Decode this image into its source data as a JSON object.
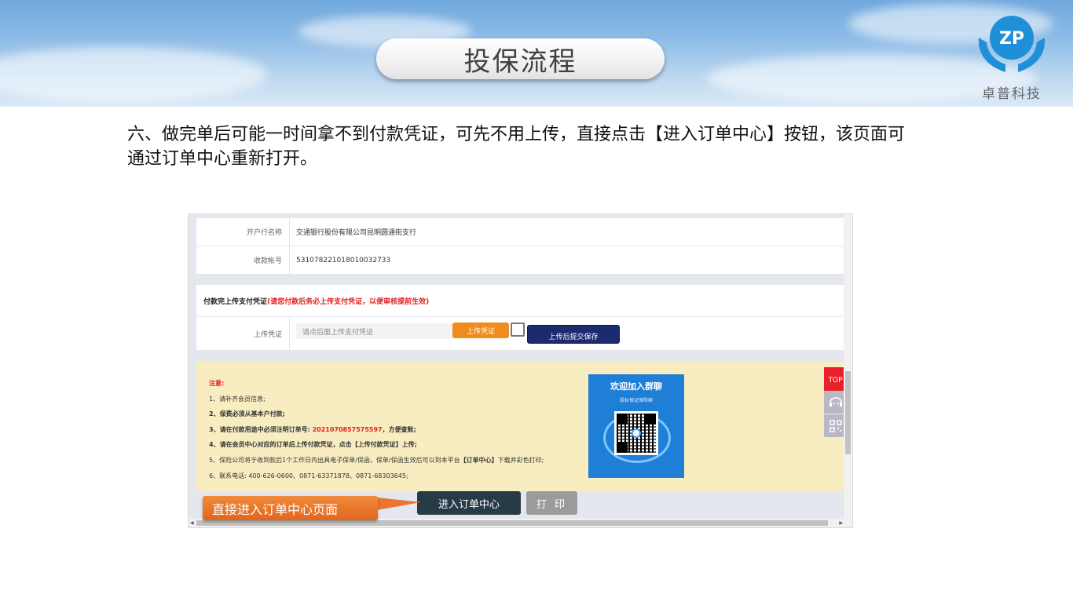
{
  "slide": {
    "title": "投保流程",
    "logo_text": "卓普科技",
    "instruction": "六、做完单后可能一时间拿不到付款凭证，可先不用上传，直接点击【进入订单中心】按钮，该页面可通过订单中心重新打开。"
  },
  "account": {
    "bank_label": "开户行名称",
    "bank_value": "交通银行股份有限公司昆明圆通街支行",
    "acct_label": "收款帐号",
    "acct_value": "531078221018010032733"
  },
  "upload": {
    "section_title": "付款完上传支付凭证",
    "section_warning": "(请您付款后务必上传支付凭证，以便审核提前生效)",
    "label": "上传凭证",
    "placeholder": "请点后面上传支付凭证",
    "upload_button": "上传凭证",
    "submit_button": "上传后提交保存"
  },
  "notice": {
    "title": "注意:",
    "l1": "1、请补齐会员信息;",
    "l2": "2、保费必须从基本户付款;",
    "l3_prefix": "3、请在付款用途中必须注明订单号: ",
    "order_no": "2021070857575597",
    "l3_suffix": "，方便查账;",
    "l4": "4、请在会员中心对应的订单后上传付款凭证，点击【上传付款凭证】上传;",
    "l5_prefix": "5、保险公司将于收到款后1个工作日内出具电子保单/保函，保单/保函生效后可以到本平台",
    "l5_bold": "【订单中心】",
    "l5_suffix": "下载并彩色打印;",
    "l6": "6、联系电话: 400-626-0600、0871-63371878、0871-68303645;"
  },
  "qr_card": {
    "title": "欢迎加入群聊",
    "subtitle": "投标保证保险群"
  },
  "side": {
    "top_label": "TOP"
  },
  "actions": {
    "order_center": "进入订单中心",
    "print": "打 印",
    "callout": "直接进入订单中心页面"
  }
}
